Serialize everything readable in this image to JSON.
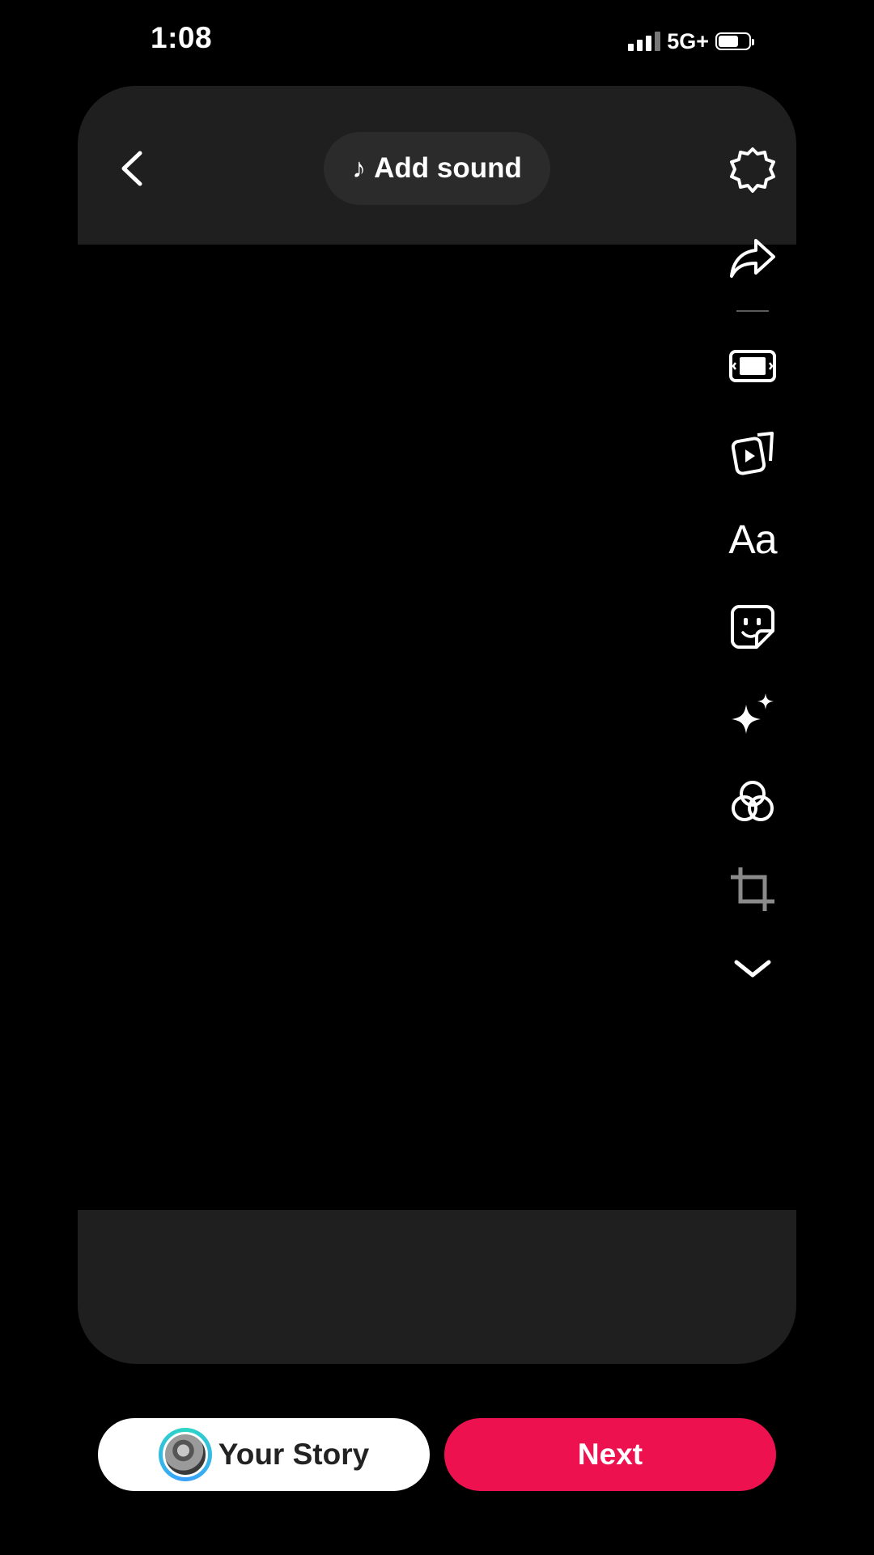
{
  "status_bar": {
    "time": "1:08",
    "network": "5G+"
  },
  "header": {
    "add_sound_label": "Add sound"
  },
  "tools": [
    {
      "name": "settings-icon"
    },
    {
      "name": "share-arrow-icon"
    },
    {
      "name": "aspect-ratio-icon"
    },
    {
      "name": "video-templates-icon"
    },
    {
      "name": "text",
      "label": "Aa"
    },
    {
      "name": "sticker-icon"
    },
    {
      "name": "effects-sparkle-icon"
    },
    {
      "name": "filters-icon"
    },
    {
      "name": "crop-icon"
    },
    {
      "name": "chevron-down-icon"
    }
  ],
  "footer": {
    "story_label": "Your Story",
    "next_label": "Next"
  },
  "colors": {
    "accent": "#ee1150",
    "card": "#1f1f1f",
    "story_ring": "#2dd7c4"
  }
}
